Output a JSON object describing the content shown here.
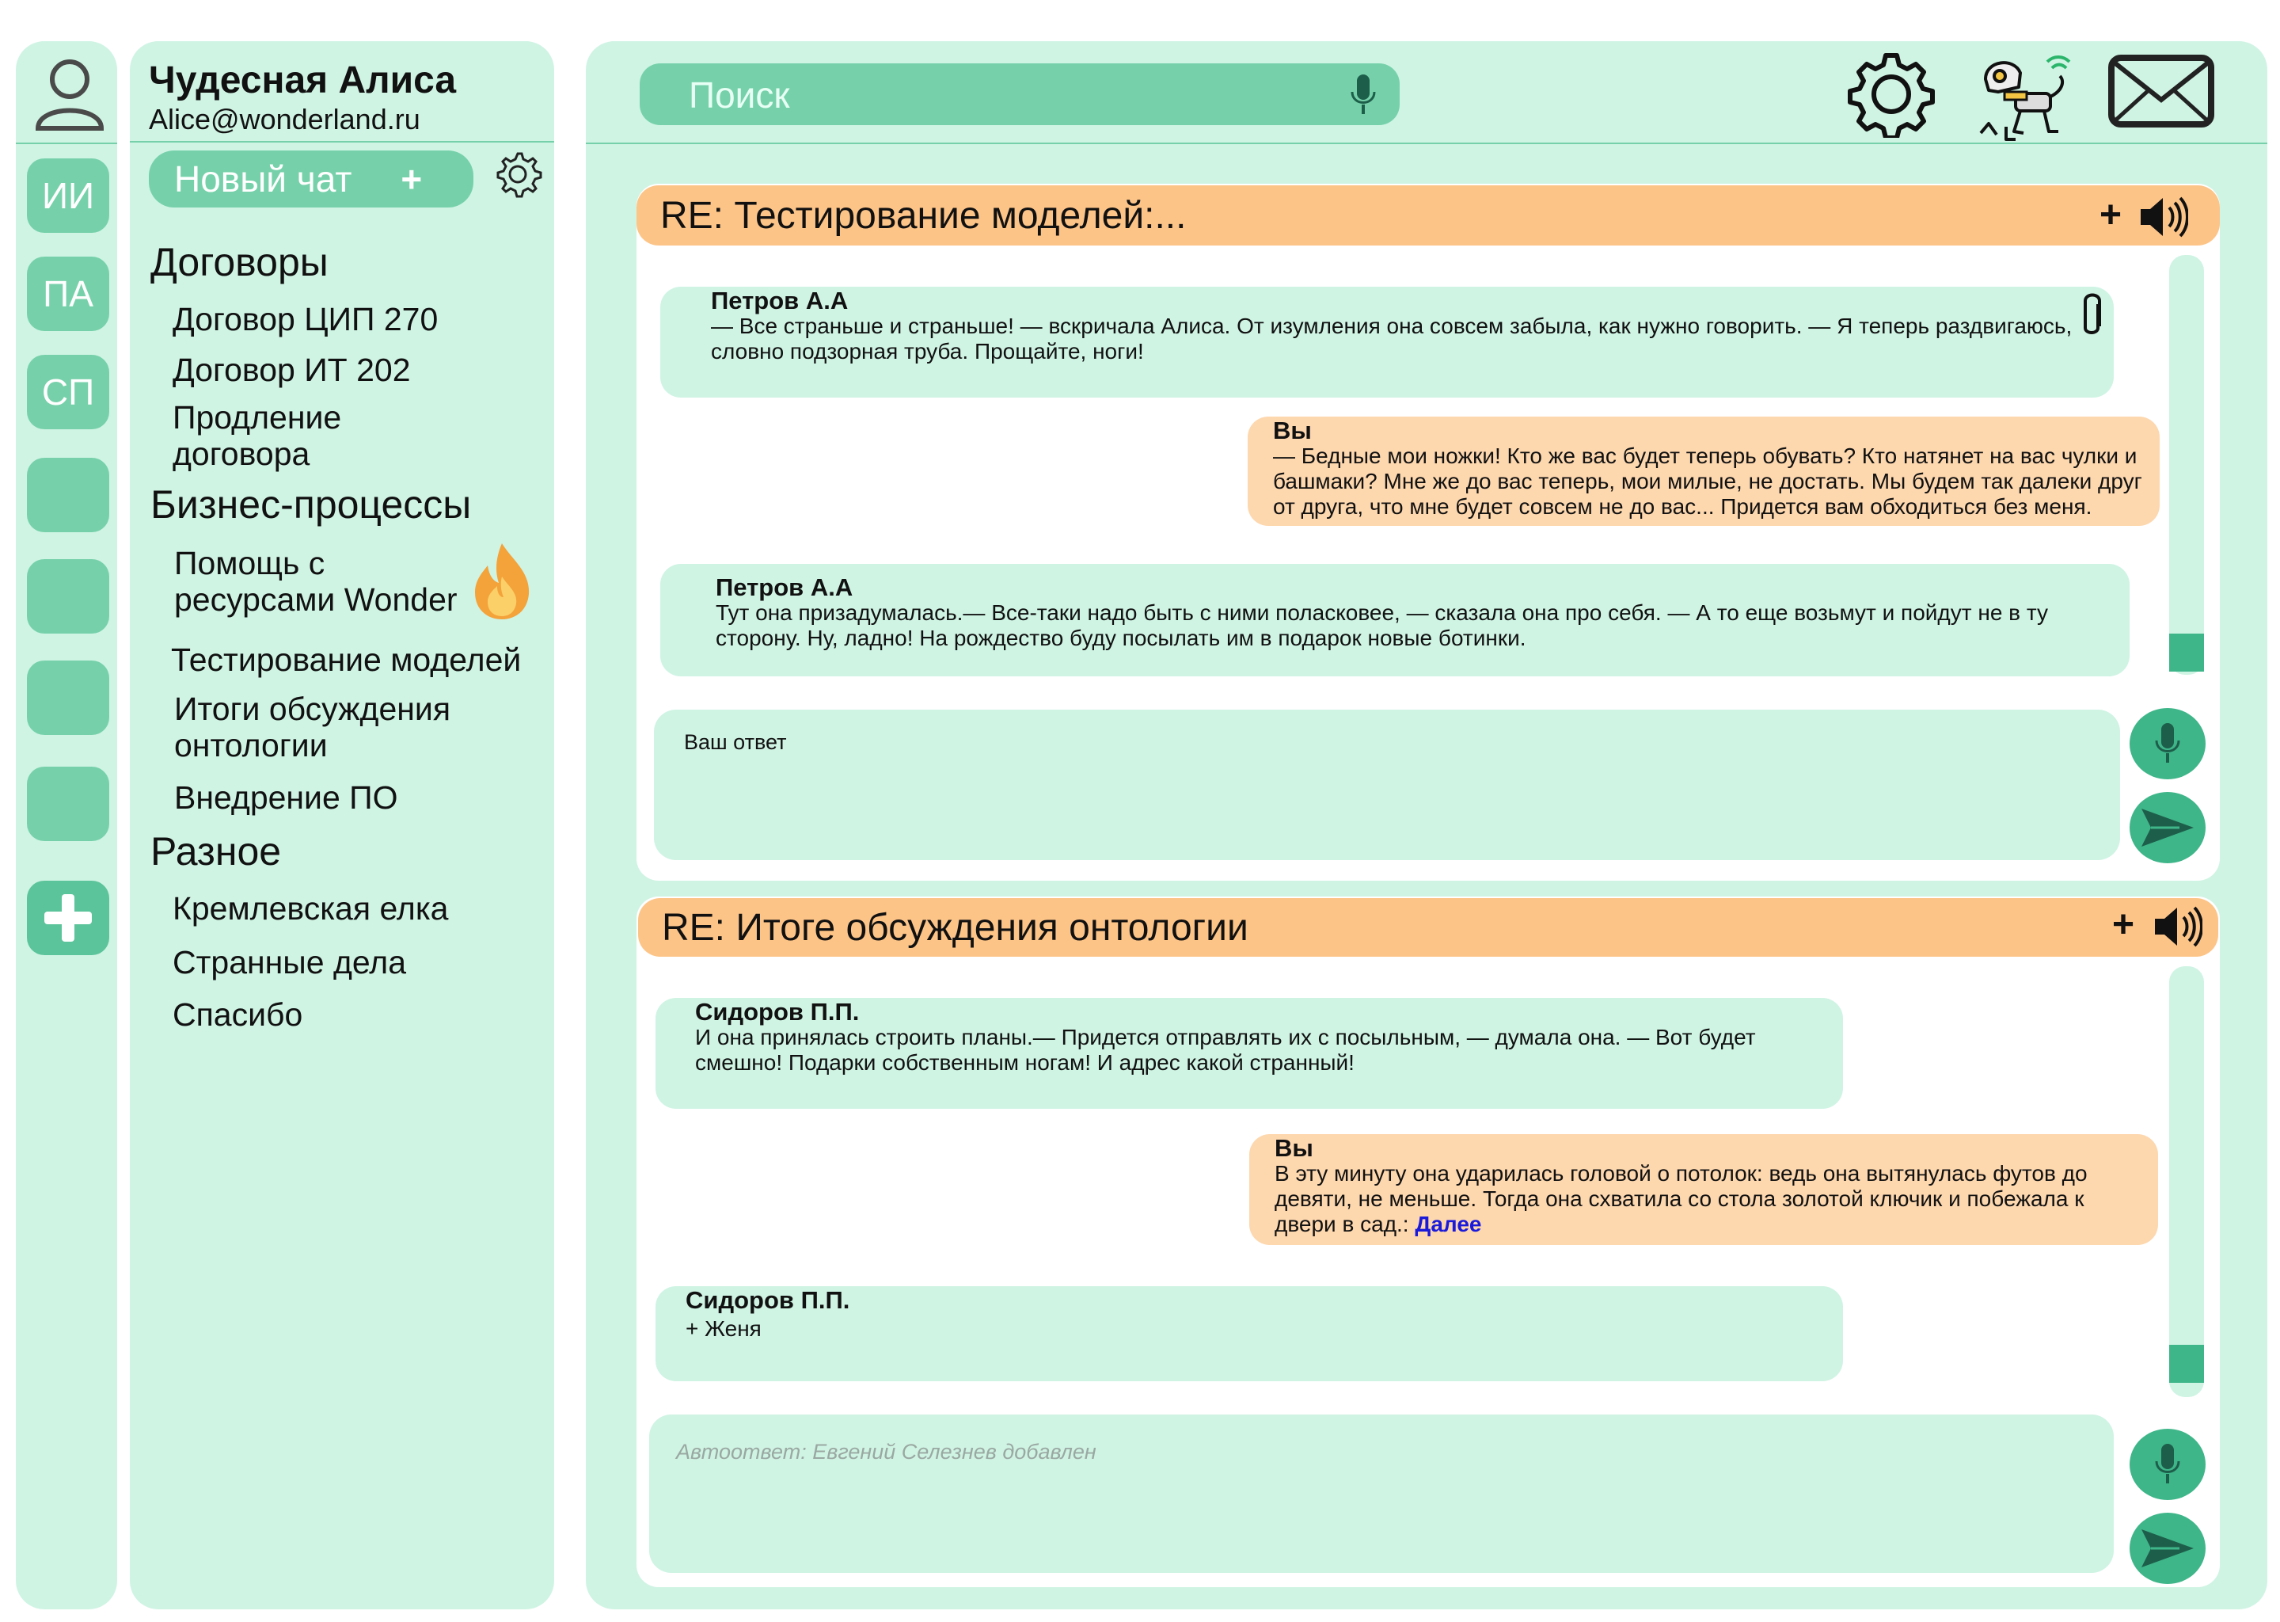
{
  "rail": {
    "buttons": [
      {
        "label": "ИИ"
      },
      {
        "label": "ПА"
      },
      {
        "label": "СП"
      },
      {
        "label": ""
      },
      {
        "label": ""
      },
      {
        "label": ""
      },
      {
        "label": ""
      }
    ],
    "add_label": "+"
  },
  "profile": {
    "name": "Чудесная Алиса",
    "email": "Alice@wonderland.ru"
  },
  "sidebar": {
    "new_chat_label": "Новый чат",
    "new_chat_plus": "+",
    "groups": [
      {
        "title": "Договоры",
        "items": [
          "Договор ЦИП 270",
          "Договор ИТ 202",
          "Продление",
          "договора"
        ]
      },
      {
        "title": "Бизнес-процессы",
        "items": [
          "Помощь с",
          "ресурсами Wonder",
          "Тестирование моделей",
          "Итоги обсуждения",
          "онтологии",
          "Внедрение ПО"
        ]
      },
      {
        "title": "Разное",
        "items": [
          "Кремлевская елка",
          "Странные дела",
          "Спасибо"
        ]
      }
    ]
  },
  "search": {
    "placeholder": "Поиск"
  },
  "threads": [
    {
      "title": "RE: Тестирование моделей:...",
      "plus": "+",
      "messages": [
        {
          "author": "Петров А.А",
          "lines": [
            "— Все страньше и страньше! — вскричала Алиса. От изумления она совсем забыла, как нужно говорить. — Я теперь раздвигаюсь,",
            "словно подзорная труба. Прощайте, ноги!"
          ]
        },
        {
          "author": "Вы",
          "lines": [
            "— Бедные мои ножки! Кто же вас будет теперь обувать? Кто натянет на вас чулки и",
            "башмаки? Мне же до вас теперь, мои милые, не достать. Мы будем так далеки друг",
            "от друга, что мне будет совсем не до вас... Придется вам обходиться без меня."
          ]
        },
        {
          "author": "Петров А.А",
          "lines": [
            "Тут она призадумалась.— Все-таки надо быть с ними поласковее, — сказала она про себя. — А то еще возьмут и пойдут не в ту",
            "сторону. Ну, ладно! На рождество буду посылать им в подарок новые ботинки."
          ]
        }
      ],
      "reply_text": "Ваш ответ"
    },
    {
      "title": "RE: Итоге обсуждения онтологии",
      "plus": "+",
      "messages": [
        {
          "author": "Сидоров П.П.",
          "lines": [
            "И она принялась строить планы.— Придется отправлять их с посыльным, — думала она. — Вот будет",
            "смешно! Подарки собственным ногам! И адрес какой странный!"
          ]
        },
        {
          "author": "Вы",
          "lines": [
            "В эту минуту она ударилась головой о потолок: ведь она вытянулась футов до",
            "девяти, не меньше. Тогда она схватила со стола золотой ключик и побежала к",
            "двери в сад.: "
          ],
          "link": "Далее"
        },
        {
          "author": "Сидоров П.П.",
          "lines": [
            "+ Женя"
          ]
        }
      ],
      "reply_placeholder": "Автоответ: Евгений Селезнев добавлен"
    }
  ],
  "colors": {
    "panel": "#cff4e4",
    "accent_green": "#76d1aa",
    "dark_green": "#3fb68a",
    "thread_header": "#fdc488",
    "out_bubble": "#fdd7ae",
    "link": "#1a1adb"
  },
  "icons": [
    "user-icon",
    "settings-gear-icon",
    "microphone-icon",
    "robot-dog-icon",
    "mail-icon",
    "speaker-icon",
    "paperclip-icon",
    "fire-icon",
    "send-icon"
  ]
}
